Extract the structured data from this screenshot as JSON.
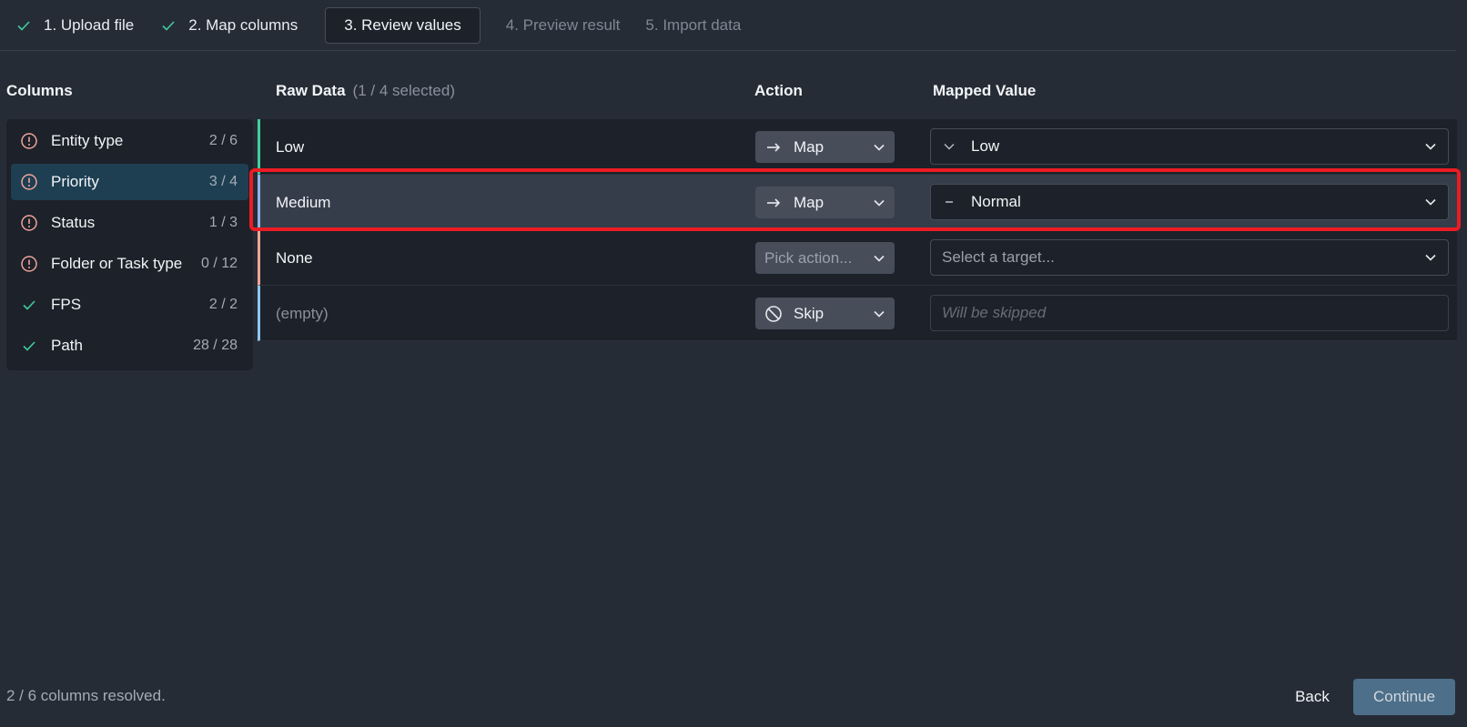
{
  "stepper": {
    "steps": [
      {
        "label": "1. Upload file",
        "state": "done"
      },
      {
        "label": "2. Map columns",
        "state": "done"
      },
      {
        "label": "3. Review values",
        "state": "active"
      },
      {
        "label": "4. Preview result",
        "state": "future"
      },
      {
        "label": "5. Import data",
        "state": "future"
      }
    ]
  },
  "columns_panel": {
    "title": "Columns",
    "items": [
      {
        "name": "Entity type",
        "count": "2 / 6",
        "status": "warning"
      },
      {
        "name": "Priority",
        "count": "3 / 4",
        "status": "warning",
        "selected": true
      },
      {
        "name": "Status",
        "count": "1 / 3",
        "status": "warning"
      },
      {
        "name": "Folder or Task type",
        "count": "0 / 12",
        "status": "warning"
      },
      {
        "name": "FPS",
        "count": "2 / 2",
        "status": "resolved"
      },
      {
        "name": "Path",
        "count": "28 / 28",
        "status": "resolved"
      }
    ]
  },
  "table": {
    "headers": {
      "raw": "Raw Data",
      "raw_selection": "(1 / 4 selected)",
      "action": "Action",
      "mapped": "Mapped Value"
    },
    "rows": [
      {
        "raw": "Low",
        "accent": "#3ecf9b",
        "action": "Map",
        "action_icon": "arrow-right-icon",
        "mapped": "Low",
        "mapped_icon": "chevron-down-priority-icon"
      },
      {
        "raw": "Medium",
        "accent": "#8fb5e8",
        "action": "Map",
        "action_icon": "arrow-right-icon",
        "mapped": "Normal",
        "mapped_icon": "dash-priority-icon",
        "highlighted": true
      },
      {
        "raw": "None",
        "accent": "#f0a49a",
        "action": "Pick action...",
        "action_placeholder": true,
        "mapped": "Select a target...",
        "mapped_placeholder": true
      },
      {
        "raw": "(empty)",
        "accent": "#8fc7ef",
        "action": "Skip",
        "action_icon": "ban-icon",
        "mapped": "Will be skipped",
        "mapped_disabled": true
      }
    ]
  },
  "footer": {
    "status": "2 / 6 columns resolved.",
    "back_label": "Back",
    "continue_label": "Continue"
  },
  "colors": {
    "background": "#262c36",
    "panel": "#1d2129",
    "selected_item": "#1e3f52",
    "check": "#3ecf9b",
    "warning": "#f0a49a",
    "highlight_border": "#ec1c24",
    "continue_button": "#4d6f8a"
  }
}
